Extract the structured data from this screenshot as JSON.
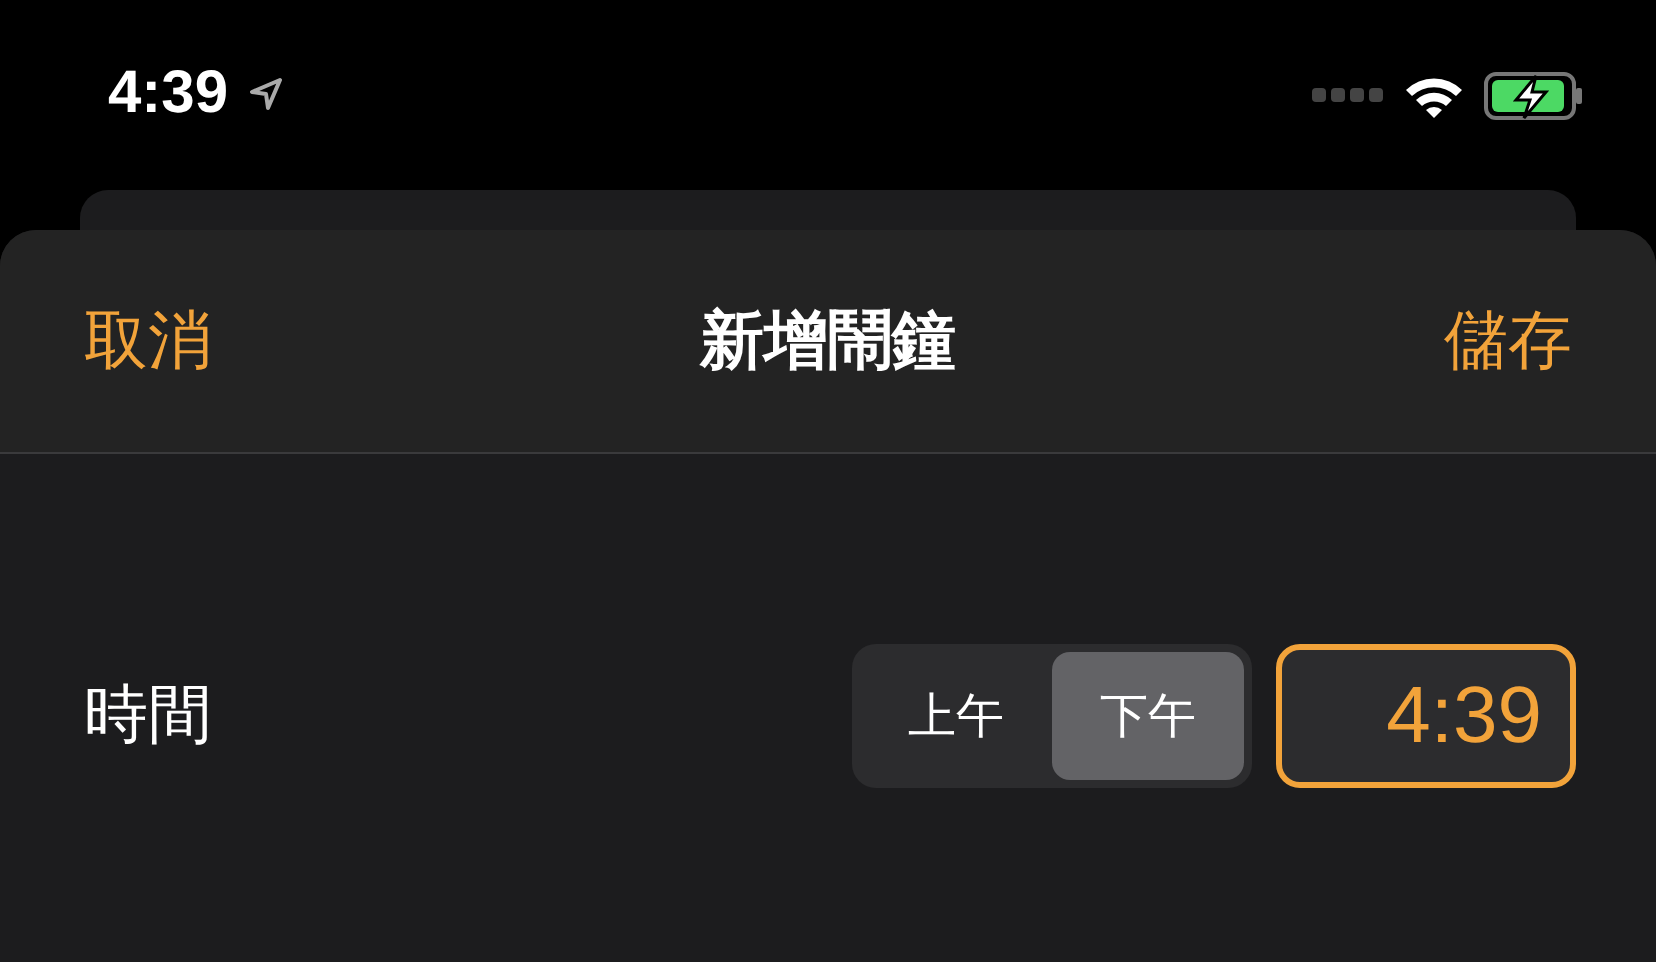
{
  "status_bar": {
    "time": "4:39",
    "location_on": true,
    "charging": true
  },
  "sheet": {
    "cancel": "取消",
    "title": "新增鬧鐘",
    "save": "儲存"
  },
  "time_row": {
    "label": "時間",
    "periods": [
      {
        "label": "上午",
        "selected": false
      },
      {
        "label": "下午",
        "selected": true
      }
    ],
    "time": "4:39"
  }
}
